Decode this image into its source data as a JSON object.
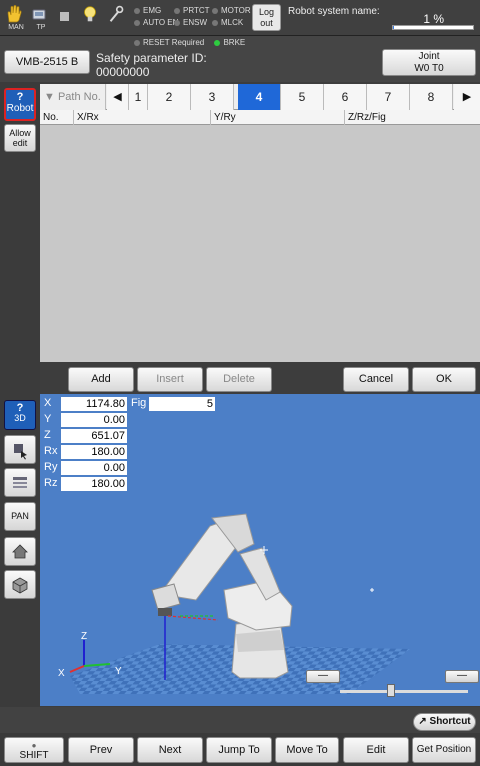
{
  "topbar": {
    "icons": [
      {
        "name": "hand-icon",
        "label": "MAN"
      },
      {
        "name": "teach-pendant-icon",
        "label": "TP"
      },
      {
        "name": "stop-square-icon",
        "label": ""
      },
      {
        "name": "lightbulb-icon",
        "label": ""
      },
      {
        "name": "wrench-icon",
        "label": ""
      }
    ],
    "leds": [
      "EMG",
      "PRTCT",
      "MOTOR",
      "AUTO EN",
      "ENSW",
      "MLCK"
    ],
    "logout_label": "Log out",
    "system_name_label": "Robot system name:",
    "speed_text": "1 %",
    "speed_fraction": 0.01
  },
  "subbar": {
    "leds": [
      "RESET Required",
      "BRKE"
    ],
    "led_colors": {
      "off": "#777777",
      "on": "#2ecc40"
    },
    "model_label": "VMB-2515 B",
    "safety_title": "Safety parameter ID:",
    "safety_id": "00000000",
    "joint_line1": "Joint",
    "joint_line2": "W0 T0"
  },
  "sidebar": {
    "robot_label": "Robot",
    "allow_edit_label": "Allow edit",
    "view_3d_label": "3D",
    "pan_label": "PAN"
  },
  "table": {
    "path_header": "Path No.",
    "tabs": [
      "1",
      "2",
      "3",
      "4",
      "5",
      "6",
      "7",
      "8"
    ],
    "active_tab": "4",
    "columns": [
      "No.",
      "X/Rx",
      "Y/Ry",
      "Z/Rz/Fig"
    ]
  },
  "actions": {
    "add": "Add",
    "insert": "Insert",
    "delete": "Delete",
    "cancel": "Cancel",
    "ok": "OK"
  },
  "coords": {
    "X": "1174.80",
    "Y": "0.00",
    "Z": "651.07",
    "Rx": "180.00",
    "Ry": "0.00",
    "Rz": "180.00",
    "fig_label": "Fig",
    "fig": "5"
  },
  "viewport": {
    "axis_labels": {
      "x": "X",
      "y": "Y",
      "z": "Z"
    },
    "minus_label": "—",
    "background": "#4c7fc7"
  },
  "bottom": {
    "shortcut": "Shortcut",
    "shift": "SHIFT",
    "prev": "Prev",
    "next": "Next",
    "jump_to": "Jump To",
    "move_to": "Move To",
    "edit": "Edit",
    "get_position": "Get Position"
  },
  "colors": {
    "accent_blue": "#1f68d8",
    "alert_red": "#dd2222"
  }
}
